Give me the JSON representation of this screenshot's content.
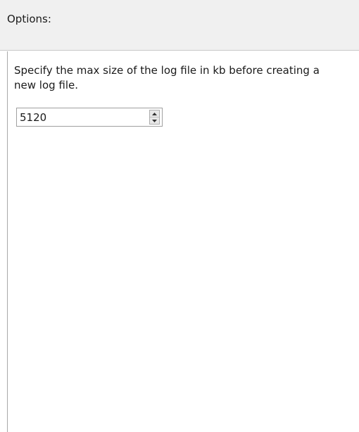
{
  "header": {
    "title": "Options:"
  },
  "options": {
    "description": "Specify the max size of the log file in kb before creating a new log file.",
    "max_log_size_kb": "5120",
    "spin_up_icon": "arrow-up-icon",
    "spin_down_icon": "arrow-down-icon"
  }
}
